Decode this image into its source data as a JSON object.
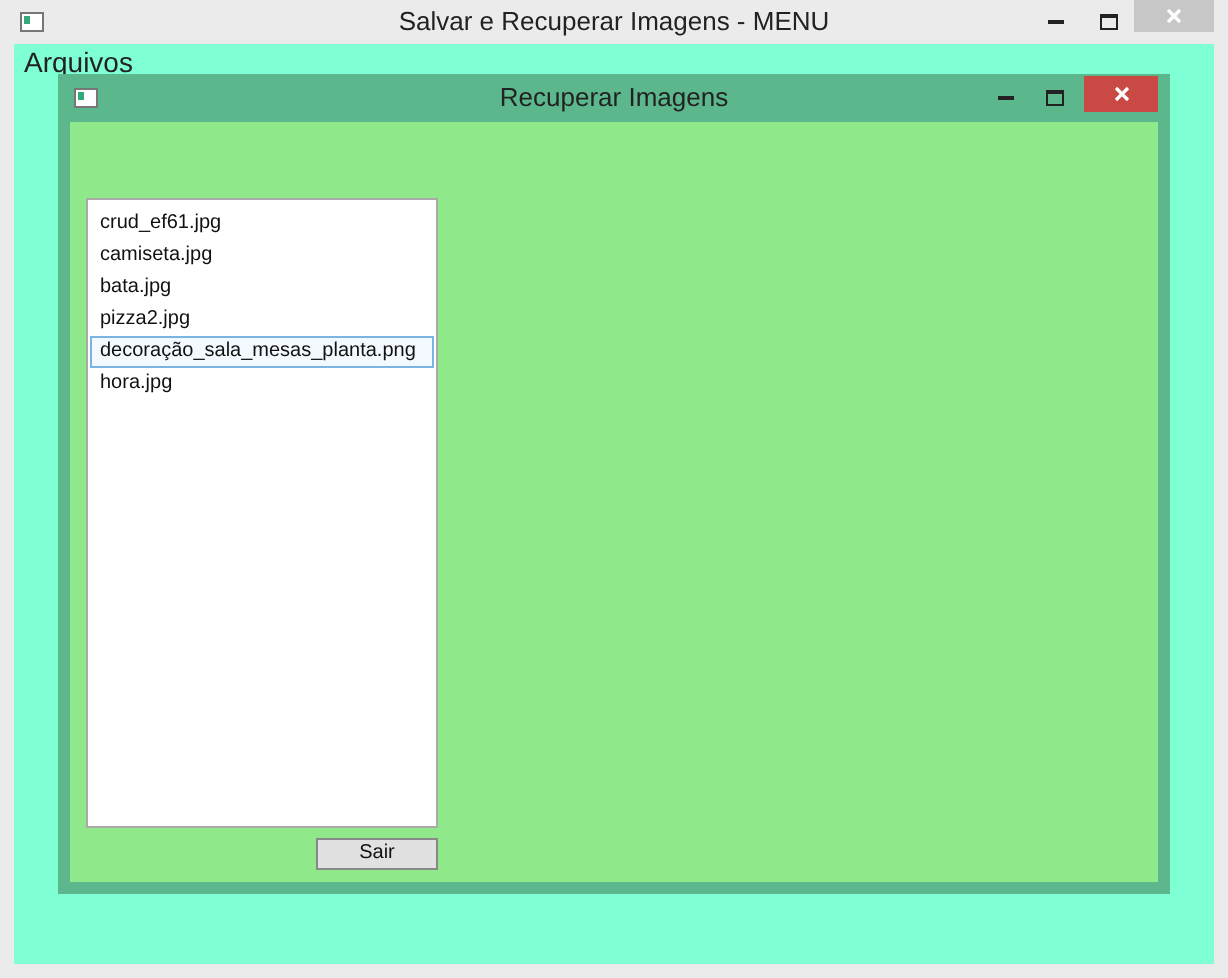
{
  "window": {
    "title": "Salvar e Recuperar Imagens - MENU"
  },
  "menu": [
    "Arquivos"
  ],
  "child_window": {
    "title": "Recuperar Imagens"
  },
  "files": [
    {
      "name": "crud_ef61.jpg",
      "selected": false
    },
    {
      "name": "camiseta.jpg",
      "selected": false
    },
    {
      "name": "bata.jpg",
      "selected": false
    },
    {
      "name": "pizza2.jpg",
      "selected": false
    },
    {
      "name": "decoração_sala_mesas_planta.png",
      "selected": true
    },
    {
      "name": "hora.jpg",
      "selected": false
    }
  ],
  "buttons": [
    "Sair"
  ]
}
